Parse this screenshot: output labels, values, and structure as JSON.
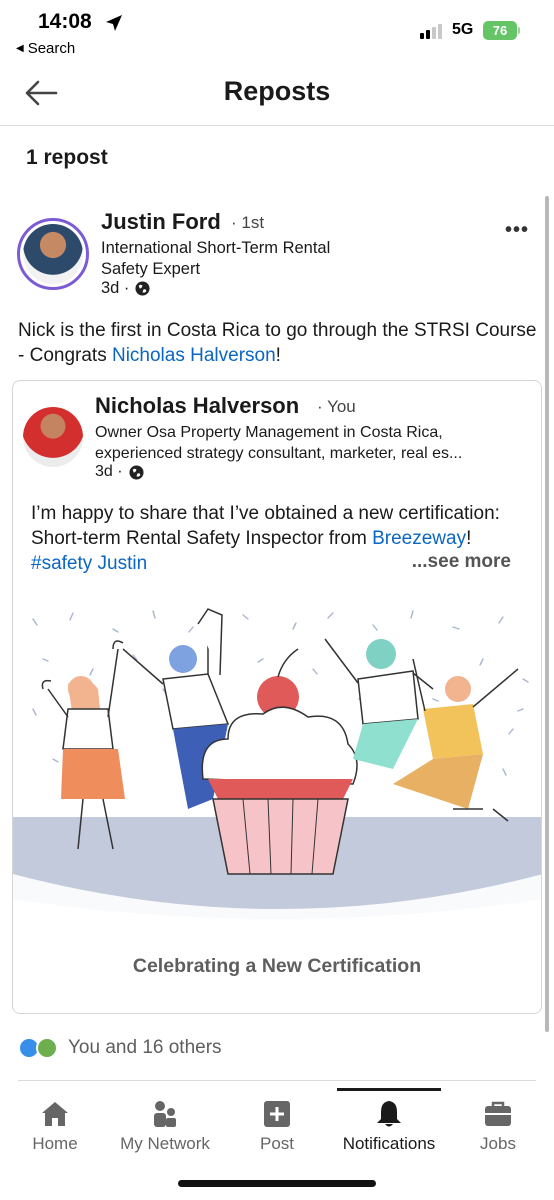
{
  "status_bar": {
    "time": "14:08",
    "back_app": "Search",
    "network": "5G",
    "battery": "76"
  },
  "header": {
    "title": "Reposts"
  },
  "repost_count": "1 repost",
  "post": {
    "author": {
      "name": "Justin Ford",
      "degree": "· 1st",
      "headline": "International Short-Term Rental Safety Expert",
      "time": "3d ·"
    },
    "text_before": "Nick is the first in Costa Rica to go through the STRSI Course - Congrats ",
    "mention": "Nicholas Halverson",
    "text_after": "!",
    "shared": {
      "author": {
        "name": "Nicholas Halverson",
        "you": "· You",
        "headline_line1": "Owner Osa Property Management in Costa Rica,",
        "headline_line2": "experienced strategy consultant, marketer, real es...",
        "time": "3d ·"
      },
      "text_before": "I’m happy to share that I’ve obtained a new certification: Short-term Rental Safety Inspector from ",
      "link_company": "Breezeway",
      "text_mid": "! ",
      "hashtag": "#safety",
      "text_space": " ",
      "mention": "Justin",
      "see_more": "...see more",
      "caption": "Celebrating a New Certification"
    },
    "reactions_text": "You and 16 others"
  },
  "bottom_nav": [
    {
      "label": "Home",
      "icon": "home-icon"
    },
    {
      "label": "My Network",
      "icon": "my-network-icon"
    },
    {
      "label": "Post",
      "icon": "post-icon"
    },
    {
      "label": "Notifications",
      "icon": "bell-icon",
      "active": true
    },
    {
      "label": "Jobs",
      "icon": "briefcase-icon"
    }
  ],
  "colors": {
    "link": "#0a66c2",
    "avatar_ring": "#7c5cd6",
    "battery": "#65c466"
  }
}
